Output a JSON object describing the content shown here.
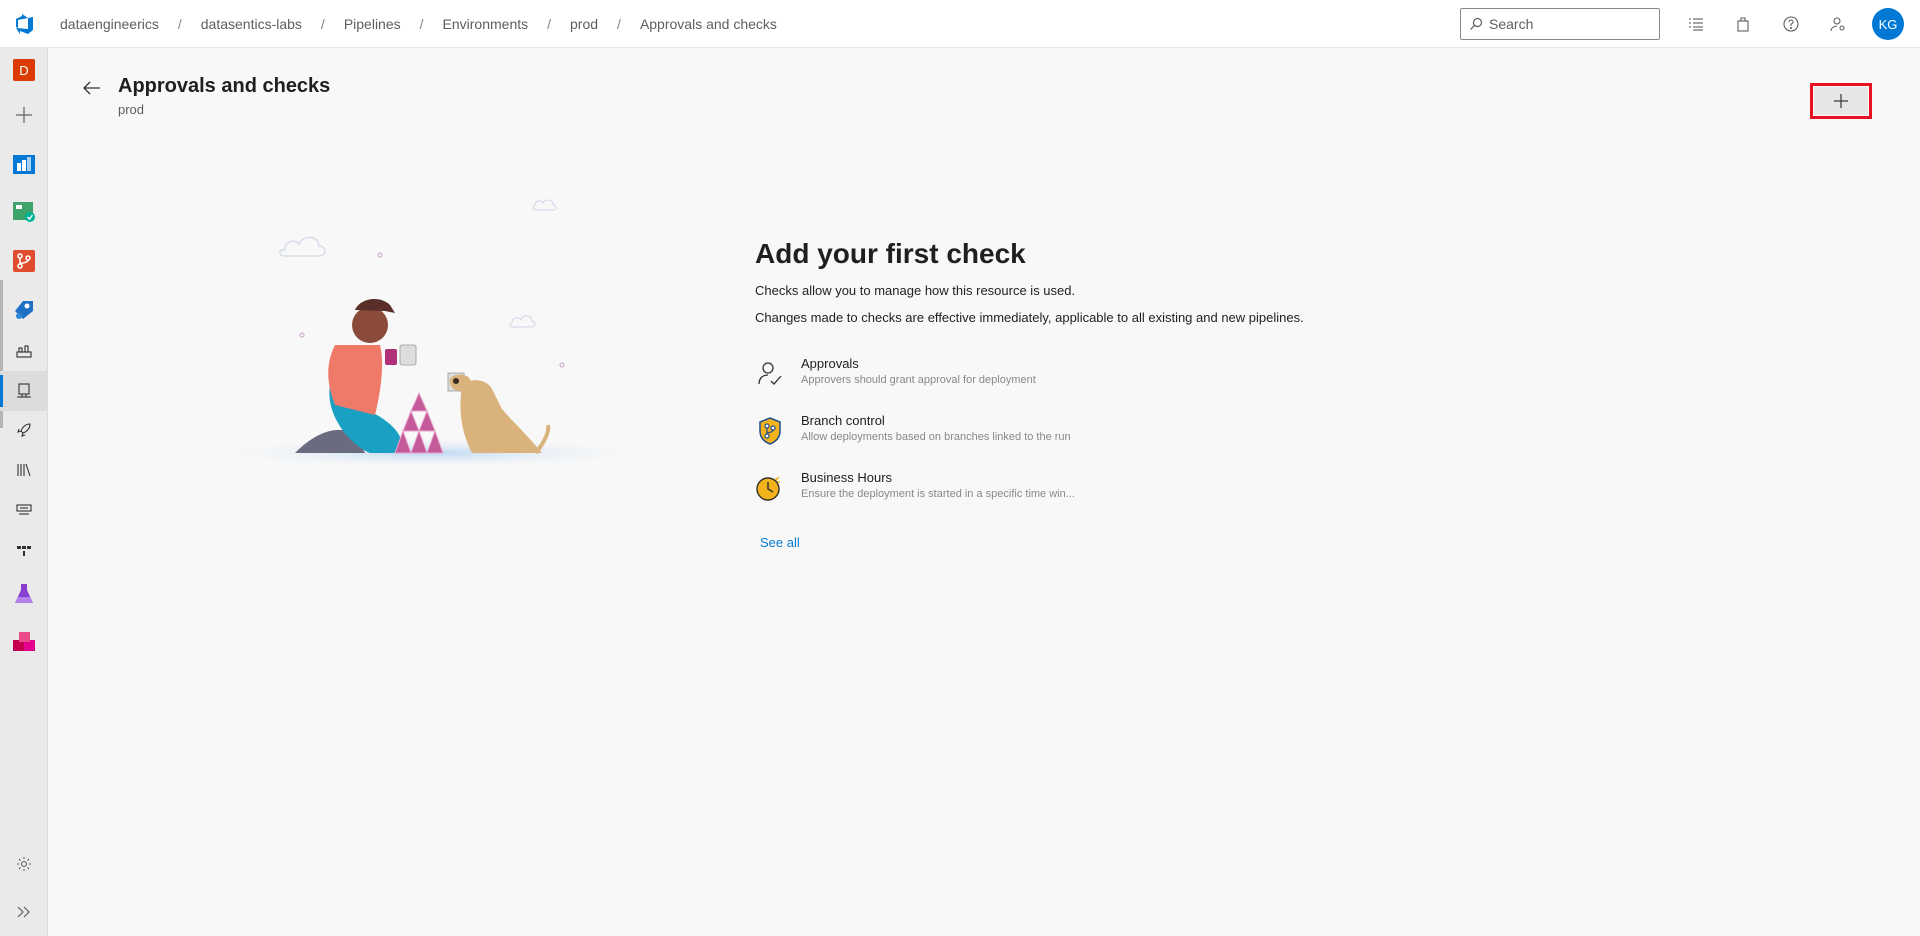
{
  "breadcrumb": [
    "dataengineerics",
    "datasentics-labs",
    "Pipelines",
    "Environments",
    "prod",
    "Approvals and checks"
  ],
  "search": {
    "placeholder": "Search"
  },
  "user": {
    "initials": "KG",
    "avatar_color": "#0078d4"
  },
  "rail": {
    "project_initial": "D",
    "items": [
      "new-item-icon",
      "boards-icon",
      "test-plans-icon",
      "repos-icon",
      "pipelines-icon",
      "pipelines-sub-icon",
      "environments-icon",
      "releases-icon",
      "library-icon",
      "task-groups-icon",
      "deployment-groups-icon",
      "test-plans-flask-icon",
      "artifacts-icon",
      "settings-gear-icon",
      "expand-icon"
    ]
  },
  "page": {
    "title": "Approvals and checks",
    "subtitle": "prod"
  },
  "empty_state": {
    "heading": "Add your first check",
    "line1": "Checks allow you to manage how this resource is used.",
    "line2": "Changes made to checks are effective immediately, applicable to all existing and new pipelines.",
    "checks": [
      {
        "name": "Approvals",
        "description": "Approvers should grant approval for deployment",
        "icon": "approvals-icon"
      },
      {
        "name": "Branch control",
        "description": "Allow deployments based on branches linked to the run",
        "icon": "branch-control-icon"
      },
      {
        "name": "Business Hours",
        "description": "Ensure the deployment is started in a specific time win...",
        "icon": "business-hours-icon"
      }
    ],
    "see_all": "See all"
  },
  "colors": {
    "accent": "#0078d4",
    "highlight": "#e81123"
  }
}
